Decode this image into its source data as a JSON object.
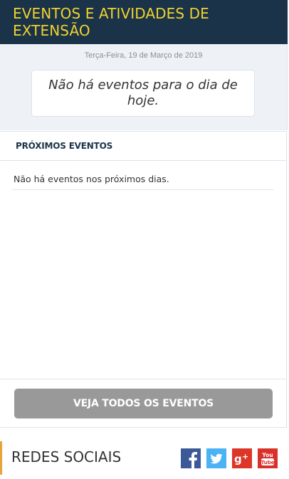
{
  "header": {
    "title": "EVENTOS E ATIVIDADES DE EXTENSÃO"
  },
  "today": {
    "date": "Terça-Feira, 19 de Março de 2019",
    "message": "Não há eventos para o dia de hoje."
  },
  "upcoming": {
    "title": "PRÓXIMOS EVENTOS",
    "empty_message": "Não há eventos nos próximos dias."
  },
  "actions": {
    "see_all_label": "VEJA TODOS OS EVENTOS"
  },
  "social": {
    "title": "REDES SOCIAIS",
    "links": [
      {
        "name": "facebook-icon",
        "color": "#3b5998",
        "glyph": "f"
      },
      {
        "name": "twitter-icon",
        "color": "#4ab3f4",
        "glyph": "twitter"
      },
      {
        "name": "google-plus-icon",
        "color": "#dd3527",
        "glyph": "g+"
      },
      {
        "name": "youtube-icon",
        "color": "#d9302a",
        "glyph": "You Tube"
      }
    ]
  }
}
